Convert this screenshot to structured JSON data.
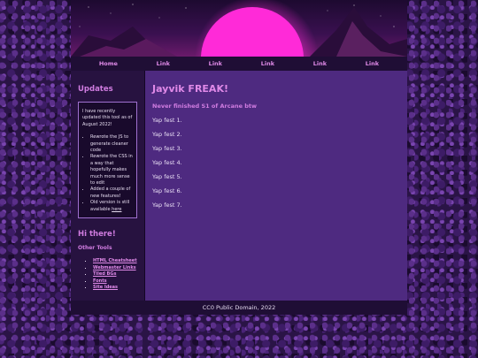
{
  "nav": {
    "items": [
      "Home",
      "Link",
      "Link",
      "Link",
      "Link",
      "Link"
    ]
  },
  "sidebar": {
    "updates_title": "Updates",
    "intro": "I have recently updated this tool as of August 2022!",
    "bullets": [
      "Rewrote the JS to generate cleaner code",
      "Rewrote the CSS in a way that hopefully makes much more sense to edit",
      "Added a couple of new features!"
    ],
    "old_version_text": "Old version is still available ",
    "old_version_link": "here",
    "greeting": "Hi there!",
    "other_tools_title": "Other Tools",
    "tools": [
      "HTML Cheatsheet",
      "Webmaster Links",
      "Tiled BGs",
      "Fonts",
      "Site Ideas"
    ]
  },
  "main": {
    "title": "Jayvik FREAK!",
    "subtitle": "Never finished S1 of Arcane btw",
    "paragraphs": [
      "Yap fest 1.",
      "Yap fest 2.",
      "Yap fest 3.",
      "Yap fest 4.",
      "Yap fest 5.",
      "Yap fest 6.",
      "Yap fest 7."
    ]
  },
  "footer": {
    "text": "CC0 Public Domain, 2022"
  },
  "colors": {
    "accent": "#e08ae8",
    "sun": "#ff2ad8",
    "main_bg": "#4e2a80",
    "sidebar_bg": "#271240"
  }
}
